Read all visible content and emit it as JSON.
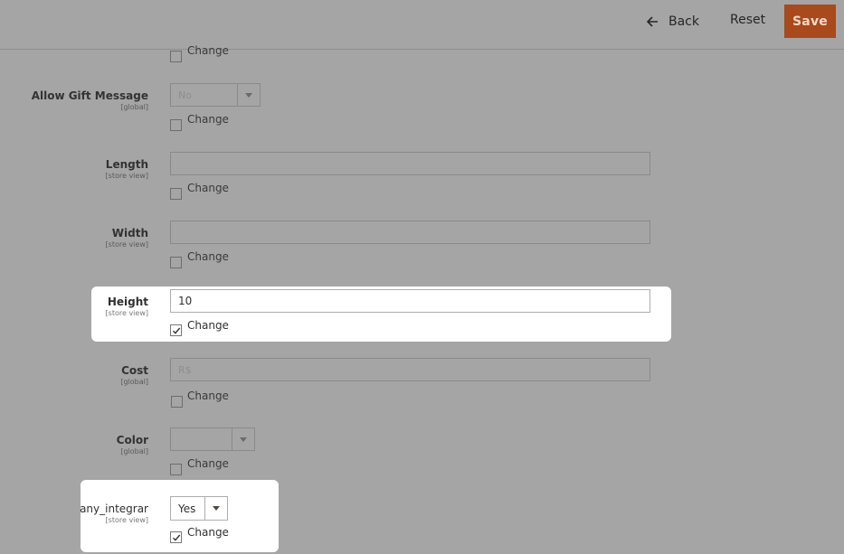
{
  "header": {
    "back_label": "Back",
    "reset_label": "Reset",
    "save_label": "Save",
    "save_color": "#eb5202"
  },
  "change_label": "Change",
  "fields": {
    "gift_message": {
      "label": "Allow Gift Message",
      "scope": "[global]",
      "value": "No"
    },
    "length": {
      "label": "Length",
      "scope": "[store view]",
      "value": ""
    },
    "width": {
      "label": "Width",
      "scope": "[store view]",
      "value": ""
    },
    "height": {
      "label": "Height",
      "scope": "[store view]",
      "value": "10",
      "change_checked": true
    },
    "cost": {
      "label": "Cost",
      "scope": "[global]",
      "placeholder": "R$"
    },
    "color": {
      "label": "Color",
      "scope": "[global]",
      "value": ""
    },
    "any_integrar": {
      "label": "any_integrar",
      "scope": "[store view]",
      "value": "Yes",
      "change_checked": true
    }
  }
}
